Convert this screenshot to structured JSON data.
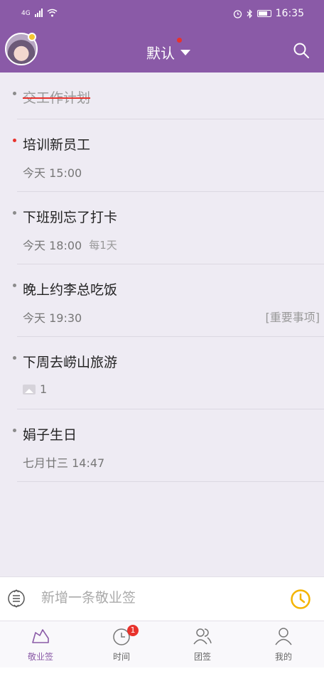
{
  "statusbar": {
    "network": "4G",
    "time": "16:35"
  },
  "header": {
    "title": "默认"
  },
  "todos": [
    {
      "title": "交工作计划",
      "done": true
    },
    {
      "title": "培训新员工",
      "time": "今天 15:00",
      "important": true
    },
    {
      "title": "下班别忘了打卡",
      "time": "今天 18:00",
      "repeat": "每1天"
    },
    {
      "title": "晚上约李总吃饭",
      "time": "今天 19:30",
      "tag": "[重要事项]"
    },
    {
      "title": "下周去崂山旅游",
      "attachments": "1"
    },
    {
      "title": "娟子生日",
      "time": "七月廿三 14:47"
    }
  ],
  "input": {
    "placeholder": "新增一条敬业签"
  },
  "nav": [
    {
      "label": "敬业签",
      "icon": "cloud-note-icon"
    },
    {
      "label": "时间",
      "icon": "clock-icon",
      "badge": "1"
    },
    {
      "label": "团签",
      "icon": "team-icon"
    },
    {
      "label": "我的",
      "icon": "person-icon"
    }
  ],
  "colors": {
    "brand": "#8a5aa7",
    "accent": "#f4b400",
    "alert": "#e8322c"
  }
}
